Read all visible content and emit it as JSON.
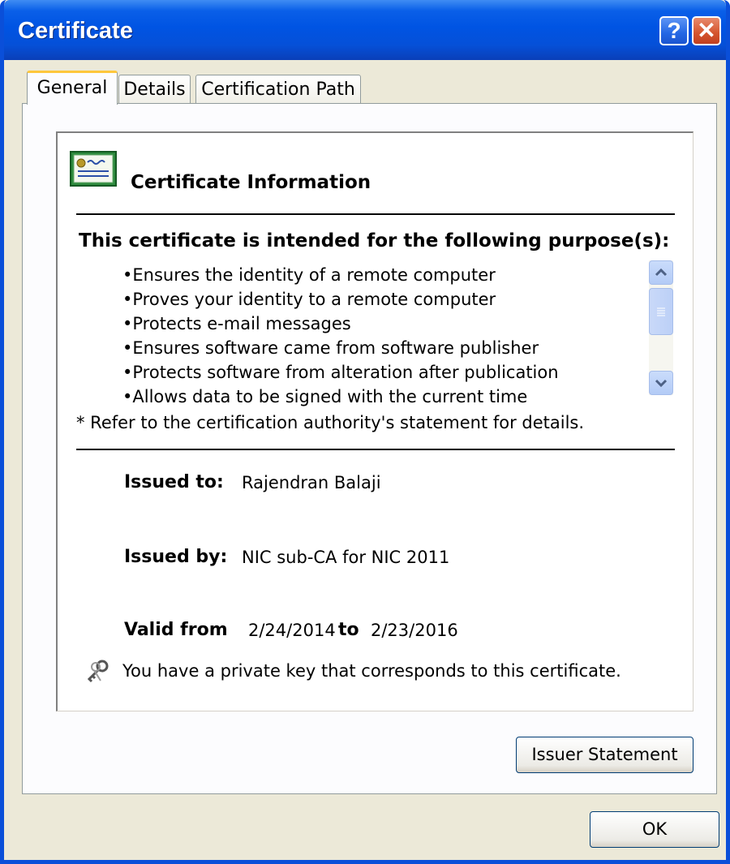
{
  "window": {
    "title": "Certificate",
    "help_glyph": "?",
    "close_glyph": "✕"
  },
  "tabs": [
    {
      "label": "General",
      "active": true
    },
    {
      "label": "Details",
      "active": false
    },
    {
      "label": "Certification Path",
      "active": false
    }
  ],
  "info": {
    "title": "Certificate Information",
    "purpose_heading": "This certificate is intended for the following purpose(s):",
    "purposes": [
      "•Ensures the identity of a remote computer",
      "•Proves your identity to a remote computer",
      "•Protects e-mail messages",
      "•Ensures software came from software publisher",
      "•Protects software from alteration after publication",
      "•Allows data to be signed with the current time"
    ],
    "footnote": "* Refer to the certification authority's statement for details.",
    "issued_to_label": "Issued to:",
    "issued_to": "Rajendran Balaji",
    "issued_by_label": "Issued by:",
    "issued_by": "NIC sub-CA for NIC 2011",
    "valid_from_label": "Valid from",
    "valid_from": "2/24/2014",
    "valid_to_label": "to",
    "valid_to": "2/23/2016",
    "private_key_note": "You have a private key that corresponds to this certificate."
  },
  "buttons": {
    "issuer_statement": "Issuer Statement",
    "ok": "OK"
  },
  "icons": {
    "certificate": "certificate-icon",
    "key": "key-icon",
    "help": "help-icon",
    "close": "close-icon"
  },
  "colors": {
    "titlebar": "#0054e3",
    "dialog_bg": "#ece9d8",
    "tab_highlight": "#ffc73c",
    "close_button": "#d4542c"
  }
}
